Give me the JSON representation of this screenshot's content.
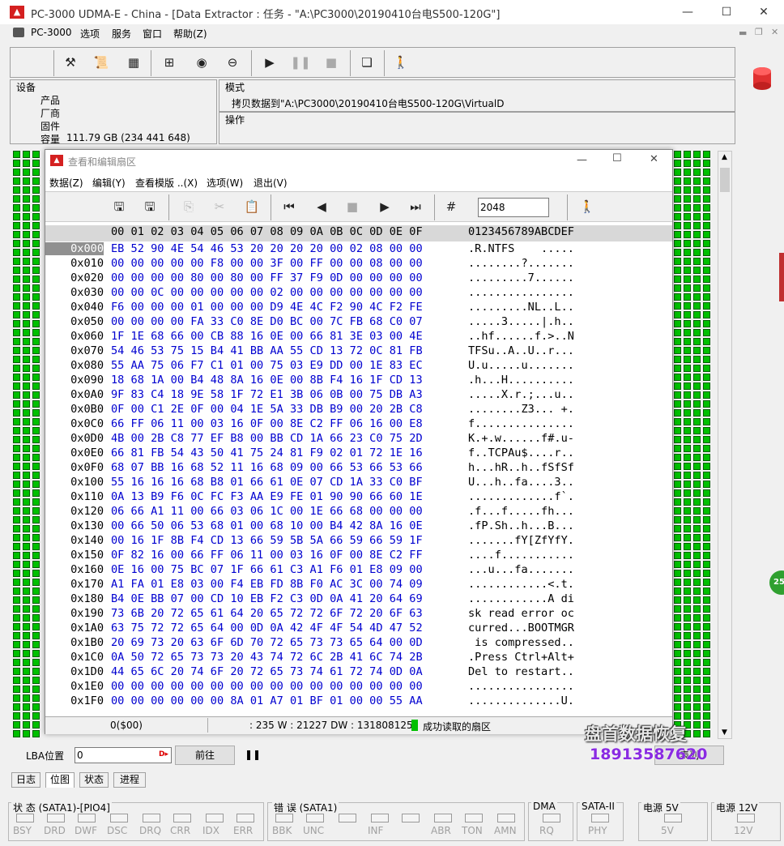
{
  "window": {
    "title": "PC-3000 UDMA-E - China - [Data Extractor : 任务 - \"A:\\PC3000\\20190410台电S500-120G\"]",
    "min": "—",
    "max": "☐",
    "close": "✕"
  },
  "menu": {
    "items": [
      "PC-3000",
      "选项",
      "服务",
      "窗口",
      "帮助(Z)"
    ]
  },
  "device": {
    "label": "设备",
    "product": "产品",
    "vendor": "厂商",
    "firmware": "固件",
    "capacity_label": "容量",
    "capacity": "111.79 GB (234 441 648)"
  },
  "mode": {
    "label": "模式",
    "value": "拷贝数据到\"A:\\PC3000\\20190410台电S500-120G\\VirtualDisk.vhd"
  },
  "operation": {
    "label": "操作"
  },
  "dialog": {
    "title": "查看和编辑扇区",
    "menu": [
      "数据(Z)",
      "编辑(Y)",
      "查看模版 ..(X)",
      "选项(W)",
      "退出(V)"
    ],
    "sector_input": "2048"
  },
  "hex": {
    "header_cols": "00 01 02 03 04 05 06 07 08 09 0A 0B 0C 0D 0E 0F",
    "header_ascii": "0123456789ABCDEF",
    "rows": [
      [
        "0x000",
        "EB 52 90 4E 54 46 53 20 20 20 20 00 02 08 00 00",
        ".R.NTFS    ....."
      ],
      [
        "0x010",
        "00 00 00 00 00 F8 00 00 3F 00 FF 00 00 08 00 00",
        "........?......."
      ],
      [
        "0x020",
        "00 00 00 00 80 00 80 00 FF 37 F9 0D 00 00 00 00",
        ".........7......"
      ],
      [
        "0x030",
        "00 00 0C 00 00 00 00 00 02 00 00 00 00 00 00 00",
        "................"
      ],
      [
        "0x040",
        "F6 00 00 00 01 00 00 00 D9 4E 4C F2 90 4C F2 FE",
        ".........NL..L.."
      ],
      [
        "0x050",
        "00 00 00 00 FA 33 C0 8E D0 BC 00 7C FB 68 C0 07",
        ".....3.....|.h.."
      ],
      [
        "0x060",
        "1F 1E 68 66 00 CB 88 16 0E 00 66 81 3E 03 00 4E",
        "..hf......f.>..N"
      ],
      [
        "0x070",
        "54 46 53 75 15 B4 41 BB AA 55 CD 13 72 0C 81 FB",
        "TFSu..A..U..r..."
      ],
      [
        "0x080",
        "55 AA 75 06 F7 C1 01 00 75 03 E9 DD 00 1E 83 EC",
        "U.u.....u......."
      ],
      [
        "0x090",
        "18 68 1A 00 B4 48 8A 16 0E 00 8B F4 16 1F CD 13",
        ".h...H.........."
      ],
      [
        "0x0A0",
        "9F 83 C4 18 9E 58 1F 72 E1 3B 06 0B 00 75 DB A3",
        ".....X.r.;...u.."
      ],
      [
        "0x0B0",
        "0F 00 C1 2E 0F 00 04 1E 5A 33 DB B9 00 20 2B C8",
        "........Z3... +."
      ],
      [
        "0x0C0",
        "66 FF 06 11 00 03 16 0F 00 8E C2 FF 06 16 00 E8",
        "f..............."
      ],
      [
        "0x0D0",
        "4B 00 2B C8 77 EF B8 00 BB CD 1A 66 23 C0 75 2D",
        "K.+.w......f#.u-"
      ],
      [
        "0x0E0",
        "66 81 FB 54 43 50 41 75 24 81 F9 02 01 72 1E 16",
        "f..TCPAu$....r.."
      ],
      [
        "0x0F0",
        "68 07 BB 16 68 52 11 16 68 09 00 66 53 66 53 66",
        "h...hR..h..fSfSf"
      ],
      [
        "0x100",
        "55 16 16 16 68 B8 01 66 61 0E 07 CD 1A 33 C0 BF",
        "U...h..fa....3.."
      ],
      [
        "0x110",
        "0A 13 B9 F6 0C FC F3 AA E9 FE 01 90 90 66 60 1E",
        ".............f`."
      ],
      [
        "0x120",
        "06 66 A1 11 00 66 03 06 1C 00 1E 66 68 00 00 00",
        ".f...f.....fh..."
      ],
      [
        "0x130",
        "00 66 50 06 53 68 01 00 68 10 00 B4 42 8A 16 0E",
        ".fP.Sh..h...B..."
      ],
      [
        "0x140",
        "00 16 1F 8B F4 CD 13 66 59 5B 5A 66 59 66 59 1F",
        ".......fY[ZfYfY."
      ],
      [
        "0x150",
        "0F 82 16 00 66 FF 06 11 00 03 16 0F 00 8E C2 FF",
        "....f..........."
      ],
      [
        "0x160",
        "0E 16 00 75 BC 07 1F 66 61 C3 A1 F6 01 E8 09 00",
        "...u...fa......."
      ],
      [
        "0x170",
        "A1 FA 01 E8 03 00 F4 EB FD 8B F0 AC 3C 00 74 09",
        "............<.t."
      ],
      [
        "0x180",
        "B4 0E BB 07 00 CD 10 EB F2 C3 0D 0A 41 20 64 69",
        "............A di"
      ],
      [
        "0x190",
        "73 6B 20 72 65 61 64 20 65 72 72 6F 72 20 6F 63",
        "sk read error oc"
      ],
      [
        "0x1A0",
        "63 75 72 72 65 64 00 0D 0A 42 4F 4F 54 4D 47 52",
        "curred...BOOTMGR"
      ],
      [
        "0x1B0",
        "20 69 73 20 63 6F 6D 70 72 65 73 73 65 64 00 0D",
        " is compressed.."
      ],
      [
        "0x1C0",
        "0A 50 72 65 73 73 20 43 74 72 6C 2B 41 6C 74 2B",
        ".Press Ctrl+Alt+"
      ],
      [
        "0x1D0",
        "44 65 6C 20 74 6F 20 72 65 73 74 61 72 74 0D 0A",
        "Del to restart.."
      ],
      [
        "0x1E0",
        "00 00 00 00 00 00 00 00 00 00 00 00 00 00 00 00",
        "................"
      ],
      [
        "0x1F0",
        "00 00 00 00 00 00 8A 01 A7 01 BF 01 00 00 55 AA",
        "..............U."
      ]
    ]
  },
  "dlg_status": {
    "offset": "0($00)",
    "counters": ": 235 W : 21227 DW : 131808125",
    "msg": "成功读取的扇区"
  },
  "lba": {
    "label": "LBA位置",
    "value": "0",
    "go": "前往",
    "pause": "❚❚",
    "list": "表列"
  },
  "tabs": [
    "日志",
    "位图",
    "状态",
    "进程"
  ],
  "status": {
    "state_title": "状 态 (SATA1)-[PIO4]",
    "state": [
      "BSY",
      "DRD",
      "DWF",
      "DSC",
      "DRQ",
      "CRR",
      "IDX",
      "ERR"
    ],
    "err_title": "错 误 (SATA1)",
    "err": [
      "BBK",
      "UNC",
      "",
      "INF",
      "",
      "ABR",
      "TON",
      "AMN"
    ],
    "dma_title": "DMA",
    "dma": "RQ",
    "sata_title": "SATA-II",
    "sata": "PHY",
    "p5_title": "电源 5V",
    "p5": "5V",
    "p12_title": "电源 12V",
    "p12": "12V"
  },
  "watermark": {
    "name": "盘首数据恢复",
    "phone": "18913587620"
  },
  "side_badge": "25"
}
